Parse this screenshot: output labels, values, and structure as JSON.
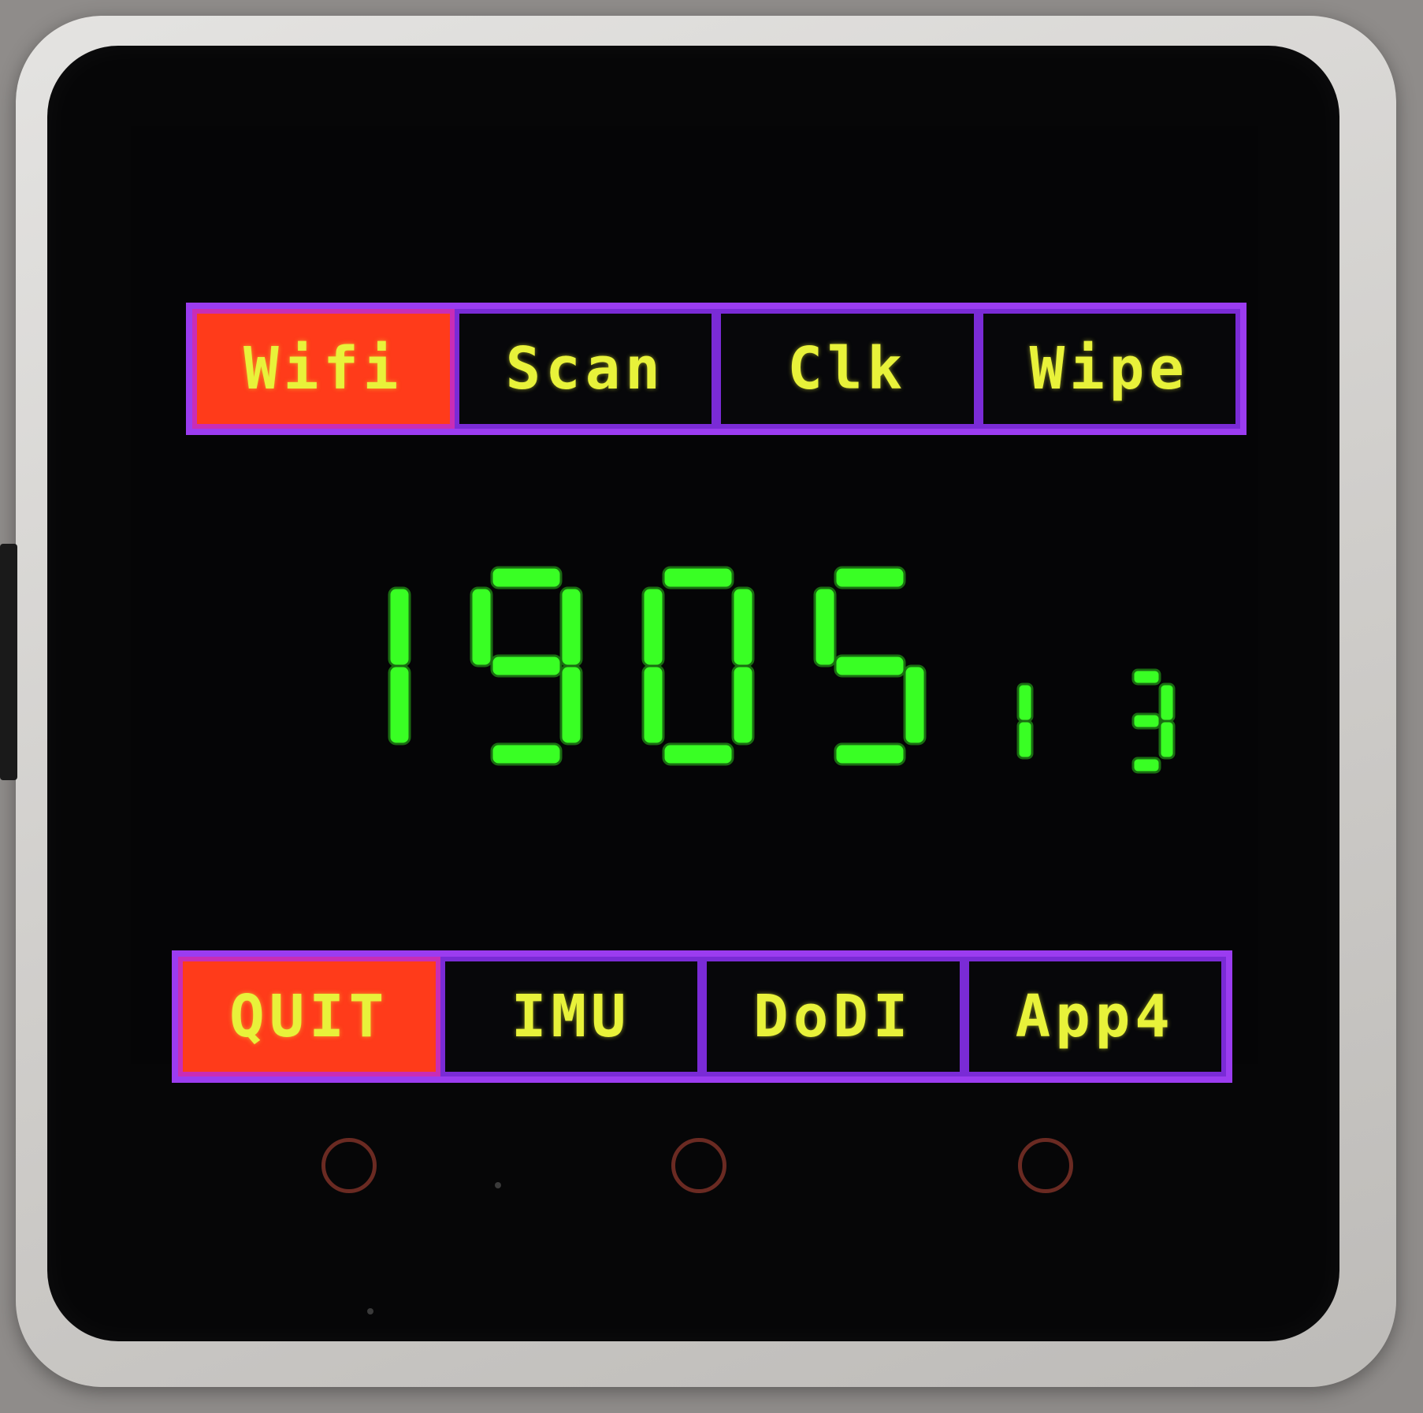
{
  "top_menu": {
    "buttons": [
      {
        "label": "Wifi",
        "active": true
      },
      {
        "label": "Scan",
        "active": false
      },
      {
        "label": "Clk",
        "active": false
      },
      {
        "label": "Wipe",
        "active": false
      }
    ]
  },
  "bottom_menu": {
    "buttons": [
      {
        "label": "QUIT",
        "active": true
      },
      {
        "label": "IMU",
        "active": false
      },
      {
        "label": "DoDI",
        "active": false
      },
      {
        "label": "App4",
        "active": false
      }
    ]
  },
  "readout": {
    "main_digits": "1905",
    "small_digits": [
      "1",
      "3"
    ]
  },
  "colors": {
    "accent_purple": "#9b3cf0",
    "active_button": "#ff3b1a",
    "label_yellow": "#e8f23a",
    "digit_green": "#39ff24",
    "screen_bg": "#050506"
  },
  "icons": [
    "touch-circle-icon",
    "touch-circle-icon",
    "touch-circle-icon"
  ]
}
